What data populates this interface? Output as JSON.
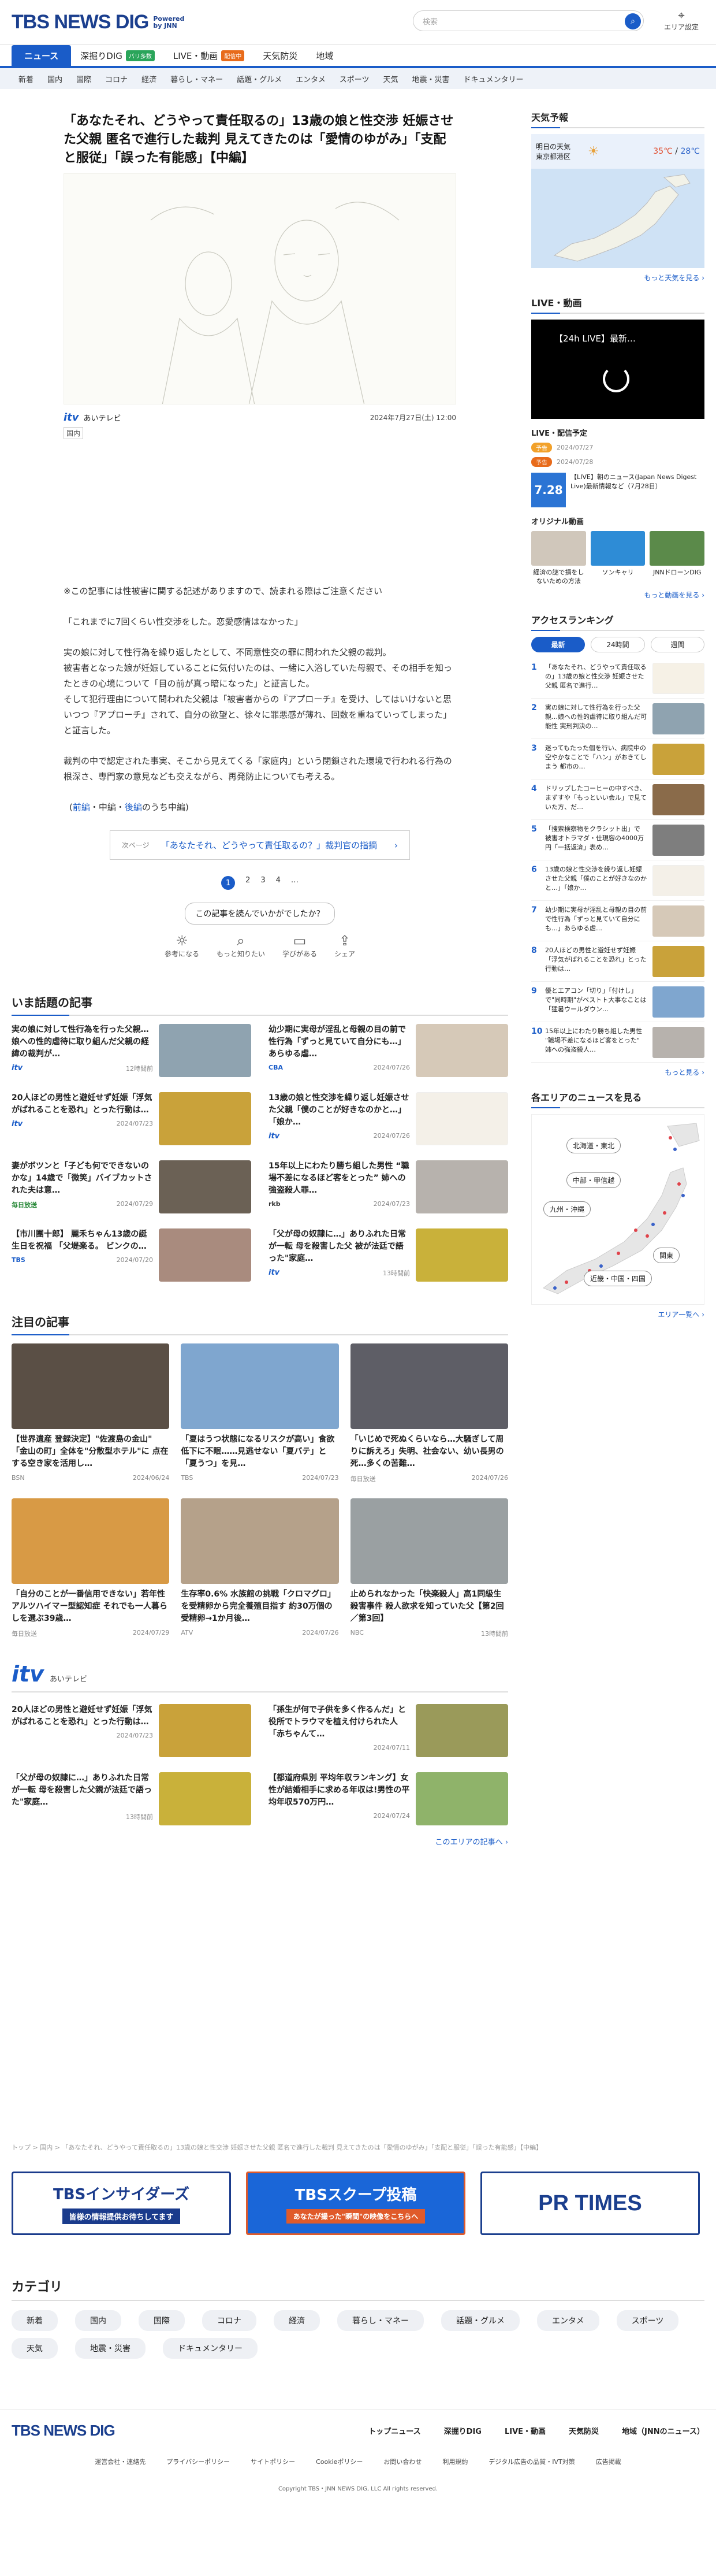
{
  "header": {
    "logo_text": "TBS NEWS DIG",
    "powered": "Powered by JNN",
    "search_placeholder": "検索",
    "area_setting": "エリア設定"
  },
  "main_nav": [
    {
      "label": "ニュース",
      "active": true
    },
    {
      "label": "深掘りDIG",
      "badge": "バリ多数",
      "badge_color": "#2aa55a"
    },
    {
      "label": "LIVE・動画",
      "badge": "配信中",
      "badge_color": "#e86b1b"
    },
    {
      "label": "天気防災"
    },
    {
      "label": "地域"
    }
  ],
  "sub_nav": [
    "新着",
    "国内",
    "国際",
    "コロナ",
    "経済",
    "暮らし・マネー",
    "話題・グルメ",
    "エンタメ",
    "スポーツ",
    "天気",
    "地震・災害",
    "ドキュメンタリー"
  ],
  "article": {
    "title": "「あなたそれ、どうやって責任取るの」13歳の娘と性交渉 妊娠させた父親 匿名で進行した裁判 見えてきたのは「愛情のゆがみ」「支配と服従」「誤った有能感」【中編】",
    "source": "itv",
    "source_name": "あいテレビ",
    "date": "2024年7月27日(土) 12:00",
    "category": "国内",
    "notice": "※この記事には性被害に関する記述がありますので、読まれる際はご注意ください",
    "quote": "「これまでに7回くらい性交渉をした。恋愛感情はなかった」",
    "para1": "実の娘に対して性行為を繰り返したとして、不同意性交の罪に問われた父親の裁判。",
    "para2": "被害者となった娘が妊娠していることに気付いたのは、一緒に入浴していた母親で、その相手を知ったときの心境について「目の前が真っ暗になった」と証言した。",
    "para3": "そして犯行理由について問われた父親は「被害者からの『アプローチ』を受け、してはいけないと思いつつ『アプローチ』されて、自分の欲望と、徐々に罪悪感が薄れ、回数を重ねていってしまった」と証言した。",
    "para4": "裁判の中で認定された事実、そこから見えてくる「家庭内」という閉鎖された環境で行われる行為の根深さ、専門家の意見なども交えながら、再発防止についても考える。",
    "series_front": "(",
    "series_links": [
      "前編",
      "中編",
      "後編"
    ],
    "series_suffix": "のうち中編)",
    "next_label": "次ページ",
    "next_title": "「あなたそれ、どうやって責任取るの？」裁判官の指摘",
    "pages": [
      "1",
      "2",
      "3",
      "4",
      "…"
    ],
    "feedback_q": "この記事を読んでいかがでしたか？",
    "reactions": [
      "参考になる",
      "もっと知りたい",
      "学びがある",
      "シェア"
    ]
  },
  "trending": {
    "title": "いま話題の記事",
    "items": [
      {
        "t": "実の娘に対して性行為を行った父親…娘への性的虐待に取り組んだ父親の経緯の裁判が…",
        "src": "itv",
        "date": "12時間前",
        "color": "#8fa3b0"
      },
      {
        "t": "幼少期に実母が淫乱と母親の目の前で性行為「ずっと見ていて自分にも…」あらゆる虐…",
        "src": "CBA",
        "date": "2024/07/26",
        "color": "#d6c9b8"
      },
      {
        "t": "20人ほどの男性と避妊せず妊娠「浮気がばれることを恐れ」とった行動は…",
        "src": "itv",
        "date": "2024/07/23",
        "color": "#c9a23a"
      },
      {
        "t": "13歳の娘と性交渉を繰り返し妊娠させた父親「僕のことが好きなのかと…」「娘か…",
        "src": "itv",
        "date": "2024/07/26",
        "color": "#f4f0e8"
      },
      {
        "t": "妻がボツンと「子ども何でできないのかな」14歳で「微笑」バイブカットされた夫は意…",
        "src": "毎日放送",
        "date": "2024/07/29",
        "color": "#6b6155"
      },
      {
        "t": "15年以上にわたり勝ち組した男性 “職場不差になるほど客をとった” 姉への強盗殺人罪…",
        "src": "rkb",
        "date": "2024/07/23",
        "color": "#b7b2ad"
      },
      {
        "t": "【市川團十郎】 麗禾ちゃん13歳の誕生日を祝福 「父堤楽る。 ビンクの…",
        "src": "TBS",
        "date": "2024/07/20",
        "color": "#a98b7e"
      },
      {
        "t": "「父が母の奴隷に…」ありふれた日常が一転 母を殺害した父 被が法廷で語った\"家庭…",
        "src": "itv",
        "date": "13時間前",
        "color": "#c9b13a"
      }
    ]
  },
  "featured": {
    "title": "注目の記事",
    "items": [
      {
        "t": "【世界遺産 登録決定】\"佐渡島の金山\" 「金山の町」全体を\"分散型ホテル\"に 点在する空き家を活用し…",
        "src": "BSN",
        "date": "2024/06/24",
        "color": "#5a4f45"
      },
      {
        "t": "「夏はうつ状態になるリスクが高い」食欲低下に不眠……見逃せない「夏バテ」と「夏うつ」を見…",
        "src": "TBS",
        "date": "2024/07/23",
        "color": "#7fa6cf"
      },
      {
        "t": "「いじめで死ぬくらいなら…大騒ぎして周りに訴えろ」失明、社会ない、幼い長男の死…多くの苦難…",
        "src": "毎日放送",
        "date": "2024/07/26",
        "color": "#5e5e66"
      },
      {
        "t": "「自分のことが一番信用できない」若年性アルツハイマー型認知症 それでも一人暮らしを選ぶ39歳…",
        "src": "毎日放送",
        "date": "2024/07/29",
        "color": "#d89a45"
      },
      {
        "t": "生存率0.6% 水族館の挑戦「クロマグロ」を受精卵から完全養殖目指す 約30万個の受精卵→1か月後…",
        "src": "ATV",
        "date": "2024/07/26",
        "color": "#b5a18a"
      },
      {
        "t": "止められなかった「快楽殺人」高1同級生殺害事件 殺人欲求を知っていた父【第2回／第3回】",
        "src": "NBC",
        "date": "13時間前",
        "color": "#9aa0a2"
      }
    ]
  },
  "itv_section": {
    "head": "itv",
    "sub": "あいテレビ",
    "items": [
      {
        "t": "20人ほどの男性と避妊せず妊娠「浮気がばれることを恐れ」とった行動は…",
        "date": "2024/07/23",
        "color": "#c9a23a"
      },
      {
        "t": "「孫生が何で子供を多く作るんだ」と役所でトラウマを植え付けられた人「赤ちゃんて…",
        "date": "2024/07/11",
        "color": "#9a9a5a"
      },
      {
        "t": "「父が母の奴隷に…」ありふれた日常が一転 母を殺害した父親が法廷で語った\"家庭…",
        "date": "13時間前",
        "color": "#c9b13a"
      },
      {
        "t": "【都道府県別 平均年収ランキング】女性が結婚相手に求める年収は!男性の平均年収570万円…",
        "date": "2024/07/24",
        "color": "#8fb36a"
      }
    ],
    "more": "このエリアの記事へ ›"
  },
  "breadcrumb": "トップ > 国内 > 「あなたそれ、どうやって責任取るの」13歳の娘と性交渉 妊娠させた父親 匿名で進行した裁判 見えてきたのは「愛情のゆがみ」「支配と服従」「誤った有能感」【中編】",
  "banners": [
    {
      "t": "TBSインサイダーズ",
      "s": "皆様の情報提供お待ちしてます"
    },
    {
      "t": "TBSスクープ投稿",
      "s": "あなたが撮った\"瞬間\"の映像をこちらへ"
    },
    {
      "t": "PR TIMES",
      "s": ""
    }
  ],
  "categories": {
    "title": "カテゴリ",
    "chips": [
      "新着",
      "国内",
      "国際",
      "コロナ",
      "経済",
      "暮らし・マネー",
      "話題・グルメ",
      "エンタメ",
      "スポーツ",
      "天気",
      "地震・災害",
      "ドキュメンタリー"
    ]
  },
  "footer": {
    "logo": "TBS NEWS DIG",
    "links": [
      "トップニュース",
      "深掘りDIG",
      "LIVE・動画",
      "天気防災",
      "地域（JNNのニュース）"
    ],
    "sub": [
      "運営会社・連絡先",
      "プライバシーポリシー",
      "サイトポリシー",
      "Cookieポリシー",
      "お問い合わせ",
      "利用規約",
      "デジタル広告の品質・IVT対策",
      "広告掲載"
    ],
    "copy": "Copyright TBS・JNN NEWS DIG, LLC All rights reserved."
  },
  "side": {
    "weather_title": "天気予報",
    "wx_day": "明日の天気",
    "wx_area": "東京都港区",
    "wx_hi": "35℃",
    "wx_lo": "28℃",
    "wx_more": "もっと天気を見る ›",
    "live_title": "LIVE・動画",
    "video_title": "【24h LIVE】最新…",
    "sched_title": "LIVE・配信予定",
    "sched1_tag": "予告",
    "sched1_date": "2024/07/27",
    "sched2_tag": "予告",
    "sched2_date": "2024/07/28",
    "live_item_date": "7.28",
    "live_item_t": "【LIVE】朝のニュース(Japan News Digest Live)最新情報など（7月28日）",
    "orig_title": "オリジナル動画",
    "orig": [
      {
        "t": "経済の謎で損をしないための方法",
        "color": "#d0c7bb"
      },
      {
        "t": "ソンキャリ",
        "color": "#2e8cd6"
      },
      {
        "t": "JNNドローンDIG",
        "color": "#5b8a4a"
      }
    ],
    "live_more": "もっと動画を見る ›",
    "rank_title": "アクセスランキング",
    "rank_tabs": [
      "最新",
      "24時間",
      "週間"
    ],
    "ranks": [
      {
        "t": "「あなたそれ、どうやって責任取るの」13歳の娘と性交渉 妊娠させた父親 匿名で進行…",
        "color": "#f6f1e6"
      },
      {
        "t": "実の娘に対して性行為を行った父親…娘への性的虐待に取り組んだ可能性 実刑判決の…",
        "color": "#8fa3b0"
      },
      {
        "t": "迷ってもたった個を行い、病院中の 空やかなことで「ハン」がおきてしまう 都市の…",
        "color": "#c9a23a"
      },
      {
        "t": "ドリップしたコーヒーの中すべき、まずすや「もっといい会ル」で見ていた方、だ…",
        "color": "#8a6b4a"
      },
      {
        "t": "「捜索検察物をクラシット出」で 被害オトラマダ・仕現容の4000万円「一括返済」表め…",
        "color": "#7e7e7e"
      },
      {
        "t": "13歳の娘と性交渉を繰り返し妊娠させた父親「僕のことが好きなのかと…」「娘か…",
        "color": "#f4f0e8"
      },
      {
        "t": "幼少期に実母が淫乱と母親の目の前で性行為「ずっと見ていて自分にも…」あらゆる虐…",
        "color": "#d6c9b8"
      },
      {
        "t": "20人ほどの男性と避妊せず妊娠「浮気がばれることを恐れ」とった行動は…",
        "color": "#c9a23a"
      },
      {
        "t": "優とエアコン「切り」「付けし」で\"同時期\"がベストト大事なことは「猛暑ウールダウン…",
        "color": "#7fa6cf"
      },
      {
        "t": "15年以上にわたり勝ち組した男性 \"職場不差になるほど客をとった\" 姉への強盗殺人…",
        "color": "#b7b2ad"
      }
    ],
    "rank_more": "もっと見る ›",
    "area_title": "各エリアのニュースを見る",
    "area_btns": [
      "北海道・東北",
      "中部・甲信越",
      "九州・沖縄",
      "関東",
      "近畿・中国・四国"
    ],
    "area_more": "エリア一覧へ ›"
  }
}
